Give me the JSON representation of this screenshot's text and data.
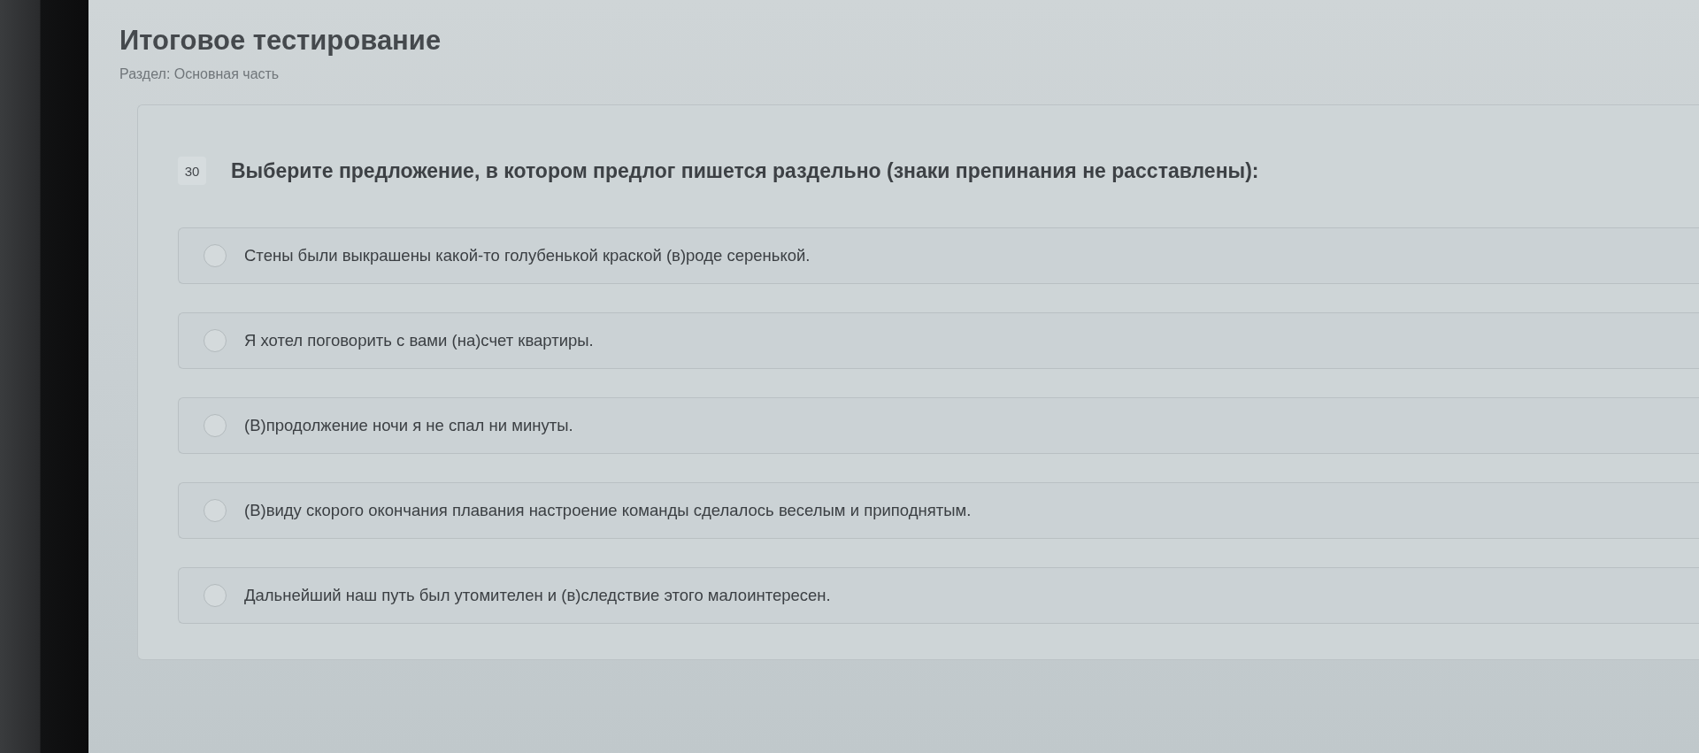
{
  "header": {
    "title": "Итоговое тестирование",
    "section": "Раздел: Основная часть"
  },
  "question": {
    "number": "30",
    "text": "Выберите предложение, в котором предлог пишется раздельно (знаки препинания не расставлены):",
    "options": [
      {
        "text": "Стены были выкрашены какой-то голубенькой краской (в)роде серенькой.",
        "selected": false
      },
      {
        "text": "Я хотел поговорить с вами (на)счет квартиры.",
        "selected": false
      },
      {
        "text": "(В)продолжение ночи я не спал ни минуты.",
        "selected": false
      },
      {
        "text": "(В)виду скорого окончания плавания настроение команды сделалось веселым и приподнятым.",
        "selected": false
      },
      {
        "text": "Дальнейший наш путь был утомителен и (в)следствие этого малоинтересен.",
        "selected": false
      }
    ]
  }
}
